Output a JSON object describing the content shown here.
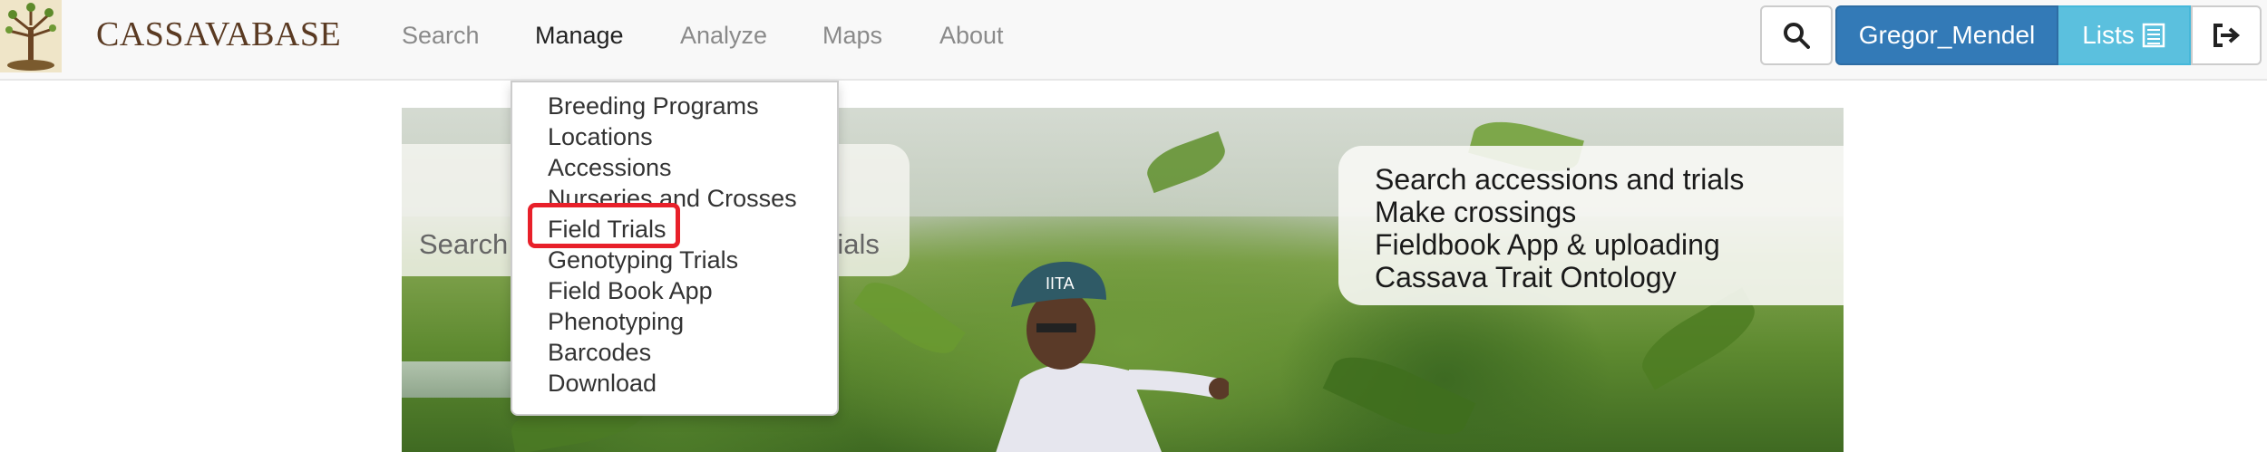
{
  "brand": {
    "name": "CASSAVABASE",
    "logo": "cassava-tree-logo"
  },
  "nav": {
    "items": [
      {
        "label": "Search",
        "active": false
      },
      {
        "label": "Manage",
        "active": true
      },
      {
        "label": "Analyze",
        "active": false
      },
      {
        "label": "Maps",
        "active": false
      },
      {
        "label": "About",
        "active": false
      }
    ]
  },
  "toolbar": {
    "search_icon": "search-icon",
    "user_label": "Gregor_Mendel",
    "lists_label": "Lists",
    "lists_icon": "list-icon",
    "logout_icon": "logout-icon"
  },
  "manage_menu": {
    "items": [
      "Breeding Programs",
      "Locations",
      "Accessions",
      "Nurseries and Crosses",
      "Field Trials",
      "Genotyping Trials",
      "Field Book App",
      "Phenotyping",
      "Barcodes",
      "Download"
    ],
    "highlighted": "Field Trials"
  },
  "hero": {
    "search_left": "Search",
    "search_right": "rials",
    "info_lines": [
      "Search accessions and trials",
      "Make crossings",
      "Fieldbook App & uploading",
      "Cassava Trait Ontology"
    ],
    "hat_text": "IITA"
  },
  "colors": {
    "brand_text": "#5a3a22",
    "primary": "#337ab7",
    "info": "#5bc0de",
    "highlight": "#e8202a"
  }
}
